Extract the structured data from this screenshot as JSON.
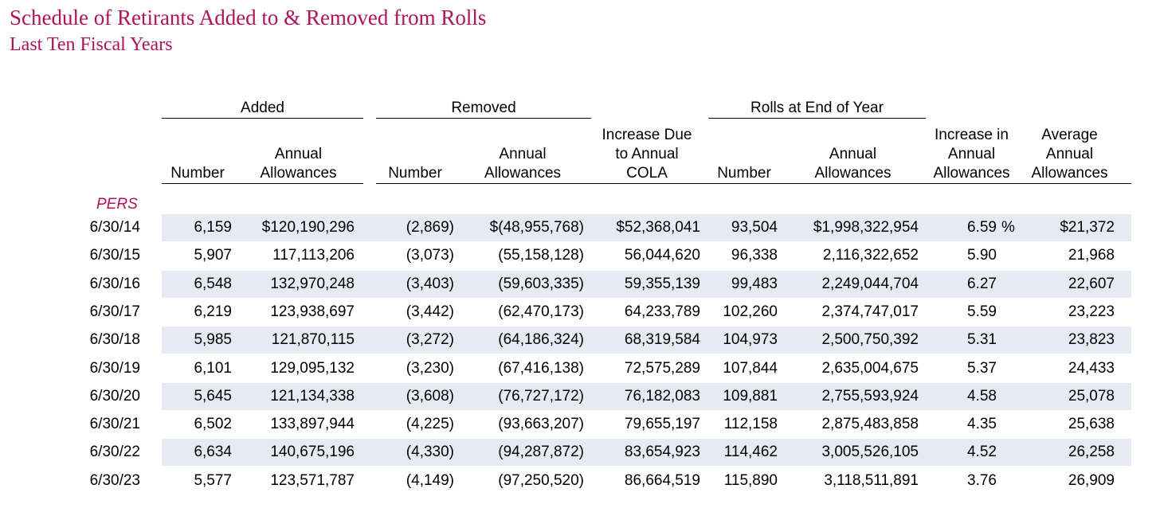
{
  "title": "Schedule of Retirants Added to & Removed from Rolls",
  "subtitle": "Last Ten Fiscal Years",
  "colors": {
    "heading": "#b0125b",
    "band": "#e6ebf3",
    "text": "#000000"
  },
  "groups": {
    "added": "Added",
    "removed": "Removed",
    "rolls": "Rolls at End of Year"
  },
  "columns": {
    "added_number": [
      "Number"
    ],
    "added_allowances": [
      "Annual",
      "Allowances"
    ],
    "removed_number": [
      "Number"
    ],
    "removed_allowances": [
      "Annual",
      "Allowances"
    ],
    "cola": [
      "Increase Due",
      "to Annual",
      "COLA"
    ],
    "rolls_number": [
      "Number"
    ],
    "rolls_allowances": [
      "Annual",
      "Allowances"
    ],
    "increase_pct": [
      "Increase in",
      "Annual",
      "Allowances"
    ],
    "average": [
      "Average",
      "Annual",
      "Allowances"
    ]
  },
  "section": "PERS",
  "rows": [
    {
      "year": "6/30/14",
      "added_number": "6,159",
      "added_allowances": "$120,190,296",
      "removed_number": "(2,869)",
      "removed_allowances": "$(48,955,768)",
      "cola": "$52,368,041",
      "rolls_number": "93,504",
      "rolls_allowances": "$1,998,322,954",
      "increase_pct": "6.59",
      "pct_sign": "%",
      "average": "$21,372"
    },
    {
      "year": "6/30/15",
      "added_number": "5,907",
      "added_allowances": "117,113,206",
      "removed_number": "(3,073)",
      "removed_allowances": "(55,158,128)",
      "cola": "56,044,620",
      "rolls_number": "96,338",
      "rolls_allowances": "2,116,322,652",
      "increase_pct": "5.90",
      "pct_sign": "",
      "average": "21,968"
    },
    {
      "year": "6/30/16",
      "added_number": "6,548",
      "added_allowances": "132,970,248",
      "removed_number": "(3,403)",
      "removed_allowances": "(59,603,335)",
      "cola": "59,355,139",
      "rolls_number": "99,483",
      "rolls_allowances": "2,249,044,704",
      "increase_pct": "6.27",
      "pct_sign": "",
      "average": "22,607"
    },
    {
      "year": "6/30/17",
      "added_number": "6,219",
      "added_allowances": "123,938,697",
      "removed_number": "(3,442)",
      "removed_allowances": "(62,470,173)",
      "cola": "64,233,789",
      "rolls_number": "102,260",
      "rolls_allowances": "2,374,747,017",
      "increase_pct": "5.59",
      "pct_sign": "",
      "average": "23,223"
    },
    {
      "year": "6/30/18",
      "added_number": "5,985",
      "added_allowances": "121,870,115",
      "removed_number": "(3,272)",
      "removed_allowances": "(64,186,324)",
      "cola": "68,319,584",
      "rolls_number": "104,973",
      "rolls_allowances": "2,500,750,392",
      "increase_pct": "5.31",
      "pct_sign": "",
      "average": "23,823"
    },
    {
      "year": "6/30/19",
      "added_number": "6,101",
      "added_allowances": "129,095,132",
      "removed_number": "(3,230)",
      "removed_allowances": "(67,416,138)",
      "cola": "72,575,289",
      "rolls_number": "107,844",
      "rolls_allowances": "2,635,004,675",
      "increase_pct": "5.37",
      "pct_sign": "",
      "average": "24,433"
    },
    {
      "year": "6/30/20",
      "added_number": "5,645",
      "added_allowances": "121,134,338",
      "removed_number": "(3,608)",
      "removed_allowances": "(76,727,172)",
      "cola": "76,182,083",
      "rolls_number": "109,881",
      "rolls_allowances": "2,755,593,924",
      "increase_pct": "4.58",
      "pct_sign": "",
      "average": "25,078"
    },
    {
      "year": "6/30/21",
      "added_number": "6,502",
      "added_allowances": "133,897,944",
      "removed_number": "(4,225)",
      "removed_allowances": "(93,663,207)",
      "cola": "79,655,197",
      "rolls_number": "112,158",
      "rolls_allowances": "2,875,483,858",
      "increase_pct": "4.35",
      "pct_sign": "",
      "average": "25,638"
    },
    {
      "year": "6/30/22",
      "added_number": "6,634",
      "added_allowances": "140,675,196",
      "removed_number": "(4,330)",
      "removed_allowances": "(94,287,872)",
      "cola": "83,654,923",
      "rolls_number": "114,462",
      "rolls_allowances": "3,005,526,105",
      "increase_pct": "4.52",
      "pct_sign": "",
      "average": "26,258"
    },
    {
      "year": "6/30/23",
      "added_number": "5,577",
      "added_allowances": "123,571,787",
      "removed_number": "(4,149)",
      "removed_allowances": "(97,250,520)",
      "cola": "86,664,519",
      "rolls_number": "115,890",
      "rolls_allowances": "3,118,511,891",
      "increase_pct": "3.76",
      "pct_sign": "",
      "average": "26,909"
    }
  ]
}
